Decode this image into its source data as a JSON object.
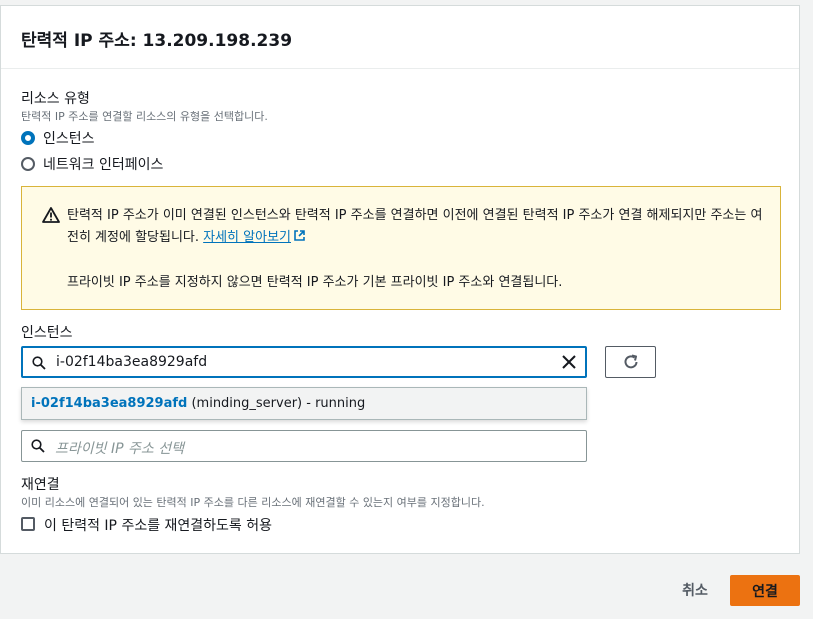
{
  "title": "탄력적 IP 주소: 13.209.198.239",
  "resource_type": {
    "label": "리소스 유형",
    "description": "탄력적 IP 주소를 연결할 리소스의 유형을 선택합니다.",
    "options": [
      {
        "label": "인스턴스",
        "checked": true
      },
      {
        "label": "네트워크 인터페이스",
        "checked": false
      }
    ]
  },
  "alert": {
    "text": "탄력적 IP 주소가 이미 연결된 인스턴스와 탄력적 IP 주소를 연결하면 이전에 연결된 탄력적 IP 주소가 연결 해제되지만 주소는 여전히 계정에 할당됩니다.",
    "link": "자세히 알아보기",
    "text2": "프라이빗 IP 주소를 지정하지 않으면 탄력적 IP 주소가 기본 프라이빗 IP 주소와 연결됩니다.",
    "color": "#d9b43a"
  },
  "instance": {
    "label": "인스턴스",
    "value": "i-02f14ba3ea8929afd"
  },
  "dropdown": {
    "id": "i-02f14ba3ea8929afd",
    "details": "(minding_server) - running"
  },
  "private_ip": {
    "placeholder": "프라이빗 IP 주소 선택"
  },
  "reassociate": {
    "label": "재연결",
    "description": "이미 리소스에 연결되어 있는 탄력적 IP 주소를 다른 리소스에 재연결할 수 있는지 여부를 지정합니다.",
    "checkbox_label": "이 탄력적 IP 주소를 재연결하도록 허용"
  },
  "footer": {
    "cancel": "취소",
    "connect": "연결"
  },
  "colors": {
    "accent": "#0073bb",
    "primary_button": "#ec7211"
  }
}
